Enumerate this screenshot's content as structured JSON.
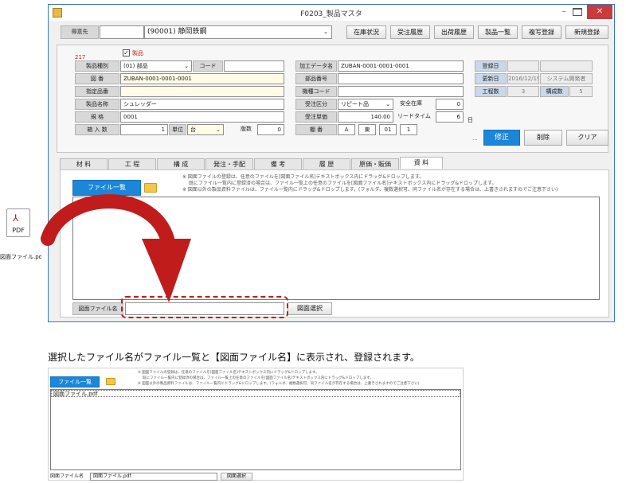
{
  "window": {
    "title": "F0203_製品マスタ",
    "minimize": "–",
    "close": "✕"
  },
  "toolbar": {
    "customer_label": "得意先",
    "customer_value": "(90001) 静岡鉄鋼",
    "buttons": [
      "在庫状況",
      "受注履歴",
      "出荷履歴",
      "製品一覧",
      "複写登録",
      "新規登録"
    ]
  },
  "form": {
    "record_no": "217",
    "checkbox_label": "製品",
    "fields": {
      "product_type_label": "製品種別",
      "product_type_value": "(01) 部品",
      "code_label": "コード",
      "drawing_no_label": "図 番",
      "drawing_no_value": "ZUBAN-0001-0001-0001",
      "designated_label": "指定品番",
      "product_name_label": "製品名称",
      "product_name_value": "シュレッダー",
      "spec_label": "規 格",
      "spec_value": "0001",
      "box_qty_label": "箱 入 数",
      "box_qty_value": "1",
      "unit_label": "単位",
      "unit_value": "台",
      "version_label": "版数",
      "version_value": "0",
      "process_data_label": "加工データ名",
      "process_data_value": "ZUBAN-0001-0001-0001",
      "part_no_label": "部品番号",
      "model_code_label": "機種コード",
      "order_type_label": "受注区分",
      "order_type_value": "リピート品",
      "safety_stock_label": "安全在庫",
      "safety_stock_value": "0",
      "unit_price_label": "受注単価",
      "unit_price_value": "140.00",
      "lead_time_label": "リードタイム",
      "lead_time_value": "6",
      "day_unit": "日",
      "shelf_label": "棚 番",
      "shelf_values": [
        "A",
        "東",
        "01",
        "1"
      ]
    },
    "meta": {
      "registered_label": "登録日",
      "updated_label": "更新日",
      "updated_date": "2016/12/19",
      "updated_by": "システム開発者",
      "process_count_label": "工程数",
      "process_count_value": "3",
      "component_count_label": "構成数",
      "component_count_value": "5"
    },
    "actions": {
      "ellipsis": "...",
      "edit": "修正",
      "delete": "削除",
      "clear": "クリア"
    }
  },
  "tabs": [
    "材 料",
    "工 程",
    "構 成",
    "発注・手配",
    "備 考",
    "履 歴",
    "原価・販価",
    "資 料"
  ],
  "documents": {
    "notes": [
      "※ 図面ファイルの登録は、任意のファイルを[図面ファイル名]テキストボックス内にドラッグ&ドロップします。",
      "既にファイル一覧内に登録済の場合は、ファイル一覧上の任意のファイルを[図面ファイル名]テキストボックス内にドラッグ&ドロップします。",
      "※ 図面以外の製品資料ファイルは、ファイル一覧内にドラッグ&ドロップします。(フォルダ、複数選択可、同ファイル名が存在する場合は、上書きされますのでご注意下さい)"
    ],
    "file_list_button": "ファイル一覧",
    "drawing_file_label": "図面ファイル名",
    "drawing_select_button": "図面選択"
  },
  "pdf_icon": {
    "badge": "PDF",
    "filename": "図面ファイル.pdf"
  },
  "caption": "選択したファイル名がファイル一覧と【図面ファイル名】に表示され、登録されます。",
  "result": {
    "file_list_button": "ファイル一覧",
    "file_entry": "図面ファイル.pdf",
    "drawing_file_label": "図面ファイル名",
    "drawing_file_value": "図面ファイル.pdf",
    "drawing_select_button": "図面選択"
  },
  "colors": {
    "accent_blue": "#1c86d8",
    "arrow_red": "#c01c1c",
    "highlight_dash": "#c01c1c",
    "close_red": "#c83c3c"
  }
}
